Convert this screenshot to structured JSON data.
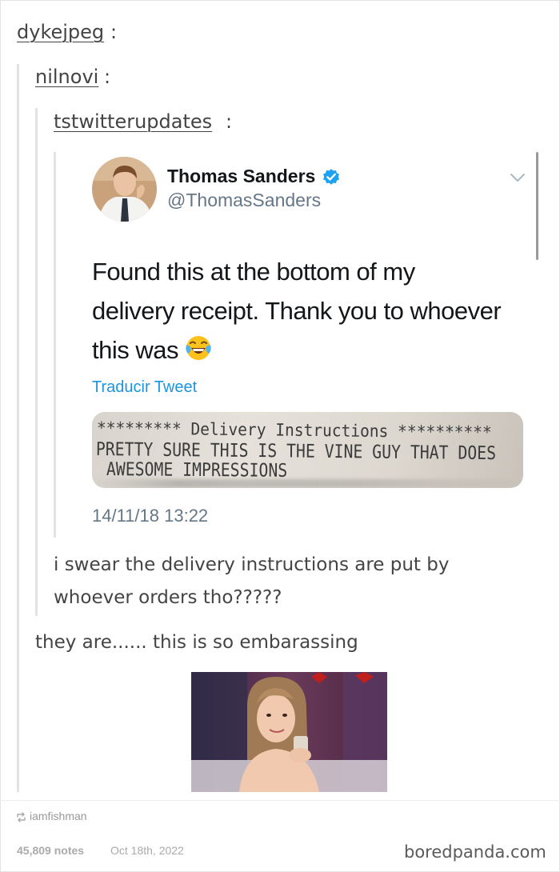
{
  "thread": {
    "users": [
      "dykejpeg",
      "nilnovi",
      "tstwitterupdates"
    ],
    "colon": ":"
  },
  "tweet": {
    "author_name": "Thomas Sanders",
    "handle": "@ThomasSanders",
    "text_lines": [
      "Found this at the bottom of my",
      "delivery receipt. Thank you to whoever",
      "this was"
    ],
    "emoji": "face-with-tears-of-joy-icon",
    "translate_label": "Traducir Tweet",
    "receipt_lines": [
      "********* Delivery Instructions **********",
      "PRETTY SURE THIS IS THE VINE GUY THAT DOES",
      "AWESOME IMPRESSIONS"
    ],
    "timestamp": "14/11/18 13:22"
  },
  "replies": {
    "nilnovi_reply_lines": [
      "i swear the delivery instructions are put by",
      "whoever orders tho?????"
    ],
    "dykejpeg_reply": "they are...... this is so embarassing"
  },
  "footer": {
    "reblogged_by": "iamfishman",
    "notes": "45,809 notes",
    "date": "Oct 18th, 2022",
    "watermark": "boredpanda.com"
  },
  "colors": {
    "twitter_blue": "#1b95e0",
    "verified_blue": "#1da1f2",
    "text_dark": "#14171a",
    "text_gray": "#657786",
    "thread_line": "#e3e3e3"
  }
}
